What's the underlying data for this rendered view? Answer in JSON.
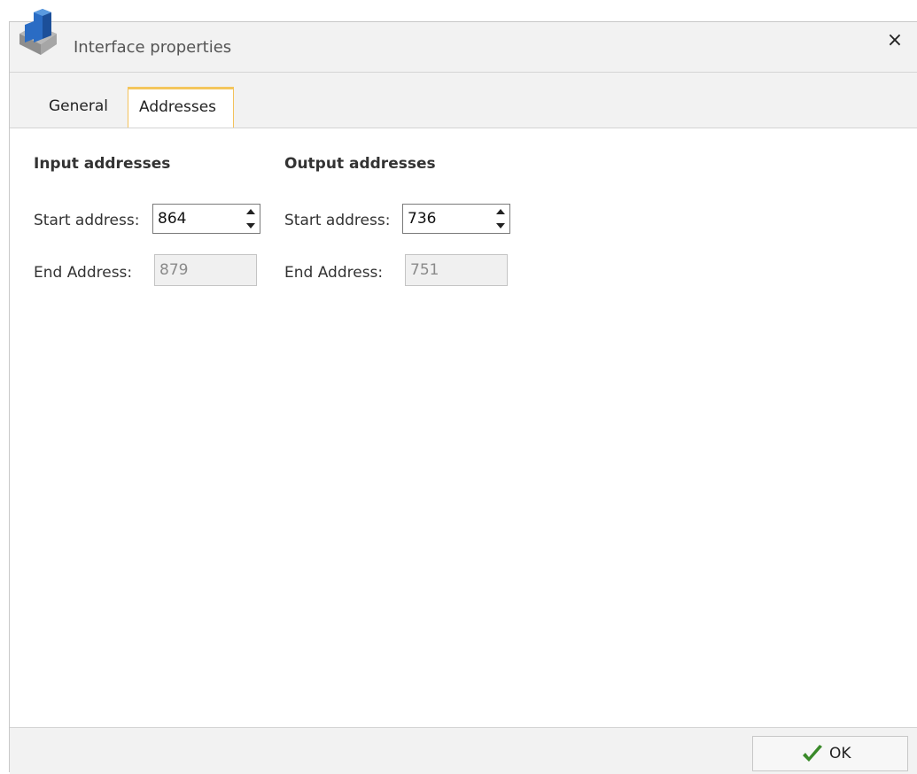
{
  "window": {
    "title": "Interface properties",
    "close_label": "×"
  },
  "tabs": [
    {
      "label": "General",
      "active": false
    },
    {
      "label": "Addresses",
      "active": true
    }
  ],
  "input_addresses": {
    "heading": "Input addresses",
    "start_label": "Start address:",
    "start_value": "864",
    "end_label": "End Address:",
    "end_value": "879"
  },
  "output_addresses": {
    "heading": "Output addresses",
    "start_label": "Start address:",
    "start_value": "736",
    "end_label": "End Address:",
    "end_value": "751"
  },
  "footer": {
    "ok_label": "OK"
  },
  "colors": {
    "active_tab_accent": "#f4c65d",
    "check_green": "#3a8a2a",
    "icon_blue": "#2a6cc4"
  },
  "icons": {
    "app": "interface-module-icon",
    "close": "close-icon",
    "ok": "checkmark-icon"
  }
}
